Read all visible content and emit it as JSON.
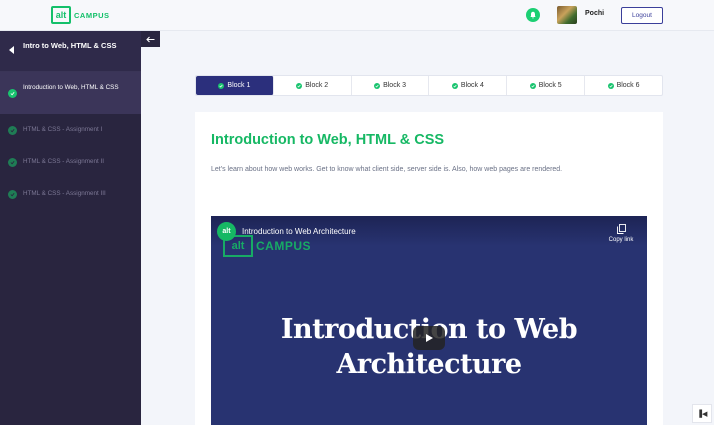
{
  "header": {
    "logo_box": "alt",
    "logo_text": "CAMPUS",
    "username": "Pochi",
    "logout_label": "Logout",
    "accent": "#14c06a"
  },
  "sidebar": {
    "title": "Intro to Web, HTML & CSS",
    "items": [
      {
        "label": "Introduction to Web, HTML & CSS",
        "active": true,
        "completed": true
      },
      {
        "label": "HTML & CSS - Assignment I",
        "active": false,
        "completed": true
      },
      {
        "label": "HTML & CSS - Assignment II",
        "active": false,
        "completed": true
      },
      {
        "label": "HTML & CSS - Assignment III",
        "active": false,
        "completed": true
      }
    ]
  },
  "tabs": [
    {
      "label": "Block 1",
      "active": true
    },
    {
      "label": "Block 2",
      "active": false
    },
    {
      "label": "Block 3",
      "active": false
    },
    {
      "label": "Block 4",
      "active": false
    },
    {
      "label": "Block 5",
      "active": false
    },
    {
      "label": "Block 6",
      "active": false
    }
  ],
  "content": {
    "title": "Introduction to Web, HTML & CSS",
    "description": "Let's learn about how web works. Get to know what client side, server side is. Also, how web pages are rendered."
  },
  "video": {
    "channel_logo": "alt",
    "title": "Introduction to Web Architecture",
    "watermark_box": "alt",
    "watermark_text": "CAMPUS",
    "copy_link_label": "Copy link",
    "heading_line1": "Introduction to Web",
    "heading_line2": "Architecture"
  },
  "corner_label": "▐◀"
}
